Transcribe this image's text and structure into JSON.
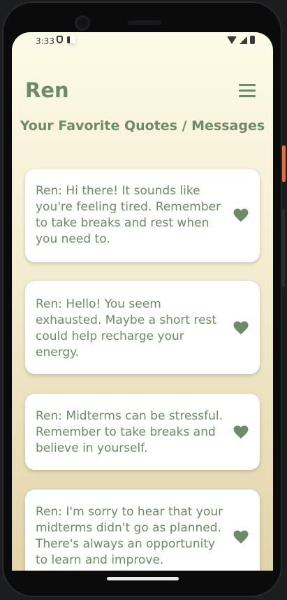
{
  "status_bar": {
    "time": "3:33",
    "left_icons": [
      "shield-icon",
      "a-icon",
      "sd-card-icon"
    ],
    "right_icons": [
      "wifi-icon",
      "signal-icon",
      "battery-icon"
    ]
  },
  "header": {
    "title": "Ren",
    "menu_icon": "hamburger-menu-icon"
  },
  "page": {
    "heading": "Your Favorite Quotes / Messages"
  },
  "messages": [
    {
      "text": "Ren: Hi there! It sounds like you're feeling tired. Remember to take breaks and rest when you need to.",
      "favorited": true
    },
    {
      "text": "Ren: Hello! You seem exhausted. Maybe a short rest could help recharge your energy.",
      "favorited": true
    },
    {
      "text": "Ren: Midterms can be stressful. Remember to take breaks and believe in yourself.",
      "favorited": true
    },
    {
      "text": "Ren: I'm sorry to hear that your midterms didn't go as planned. There's always an opportunity to learn and improve.",
      "favorited": true
    }
  ],
  "colors": {
    "accent": "#6e8a68",
    "background_top": "#fdfbe6",
    "background_bottom": "#e2d3a9",
    "card": "#ffffff"
  }
}
